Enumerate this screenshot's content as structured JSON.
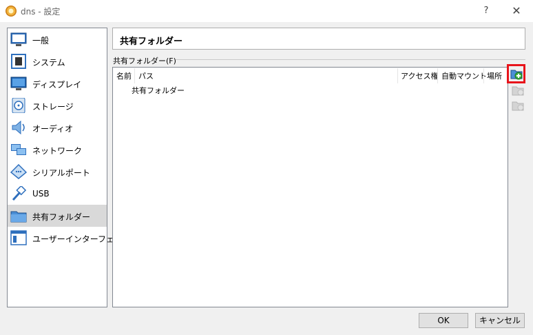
{
  "window": {
    "title": "dns - 設定",
    "help": "?",
    "close": "✕"
  },
  "sidebar": {
    "items": [
      {
        "label": "一般",
        "icon": "general-icon"
      },
      {
        "label": "システム",
        "icon": "system-icon"
      },
      {
        "label": "ディスプレイ",
        "icon": "display-icon"
      },
      {
        "label": "ストレージ",
        "icon": "storage-icon"
      },
      {
        "label": "オーディオ",
        "icon": "audio-icon"
      },
      {
        "label": "ネットワーク",
        "icon": "network-icon"
      },
      {
        "label": "シリアルポート",
        "icon": "serial-port-icon"
      },
      {
        "label": "USB",
        "icon": "usb-icon"
      },
      {
        "label": "共有フォルダー",
        "icon": "shared-folder-icon",
        "selected": true
      },
      {
        "label": "ユーザーインターフェース",
        "icon": "user-interface-icon"
      }
    ]
  },
  "page": {
    "title": "共有フォルダー"
  },
  "shared_folders": {
    "group_label": "共有フォルダー(F)",
    "columns": [
      "名前",
      "パス",
      "アクセス権",
      "自動マウント",
      "場所"
    ],
    "rows": [
      "共有フォルダー"
    ]
  },
  "actions": {
    "add": "add-shared-folder-icon",
    "edit": "edit-shared-folder-icon",
    "remove": "remove-shared-folder-icon"
  },
  "footer": {
    "ok": "OK",
    "cancel": "キャンセル"
  },
  "colors": {
    "highlight": "#e8141b",
    "selected": "#d9d9d9"
  }
}
